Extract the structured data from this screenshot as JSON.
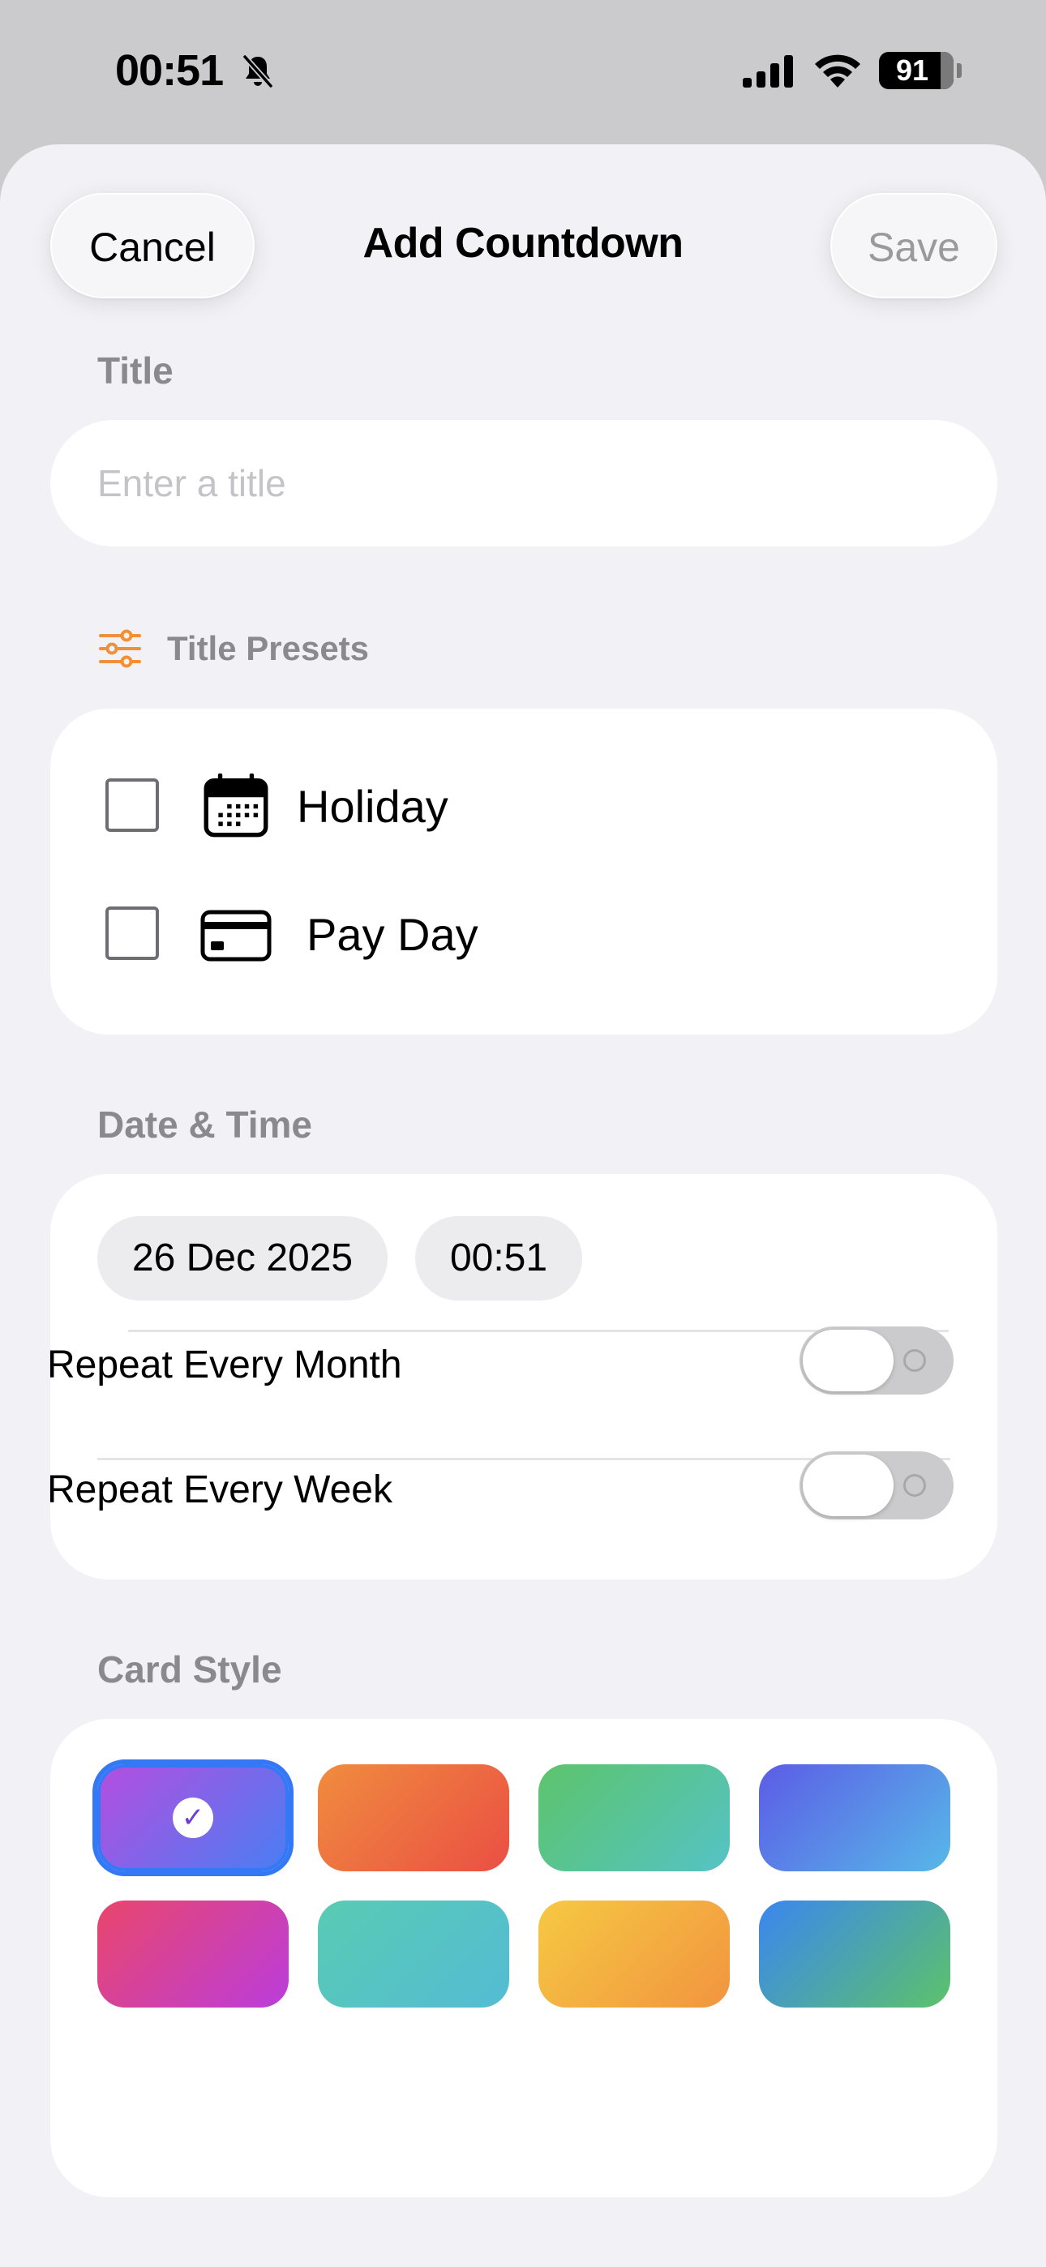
{
  "status_bar": {
    "time": "00:51",
    "battery": "91",
    "icons": [
      "bell-slash-icon",
      "cellular-signal-icon",
      "wifi-icon",
      "battery-icon"
    ]
  },
  "header": {
    "cancel_label": "Cancel",
    "title": "Add Countdown",
    "save_label": "Save"
  },
  "title_section": {
    "label": "Title",
    "placeholder": "Enter a title",
    "value": ""
  },
  "presets": {
    "label": "Title Presets",
    "icon": "sliders-icon",
    "accent_color": "#f0913a",
    "items": [
      {
        "label": "Holiday",
        "icon": "calendar-icon",
        "checked": false
      },
      {
        "label": "Pay Day",
        "icon": "credit-card-icon",
        "checked": false
      }
    ]
  },
  "date_time": {
    "label": "Date & Time",
    "date": "26 Dec 2025",
    "time": "00:51",
    "toggles": [
      {
        "label": "Repeat Every Month",
        "on": false
      },
      {
        "label": "Repeat Every Week",
        "on": false
      }
    ]
  },
  "card_style": {
    "label": "Card Style",
    "selected_index": 0,
    "selection_color": "#3478f6",
    "swatches": [
      {
        "from": "#b34fe0",
        "to": "#4a7df2"
      },
      {
        "from": "#f08c3e",
        "to": "#ea4f44"
      },
      {
        "from": "#5cc46b",
        "to": "#55c3c6"
      },
      {
        "from": "#5c5ce6",
        "to": "#57b8e8"
      },
      {
        "from": "#e9466c",
        "to": "#bb3ddc"
      },
      {
        "from": "#58cbb3",
        "to": "#54bcd4"
      },
      {
        "from": "#f6c942",
        "to": "#f29440"
      },
      {
        "from": "#3a86f0",
        "to": "#5dc26a"
      }
    ]
  }
}
